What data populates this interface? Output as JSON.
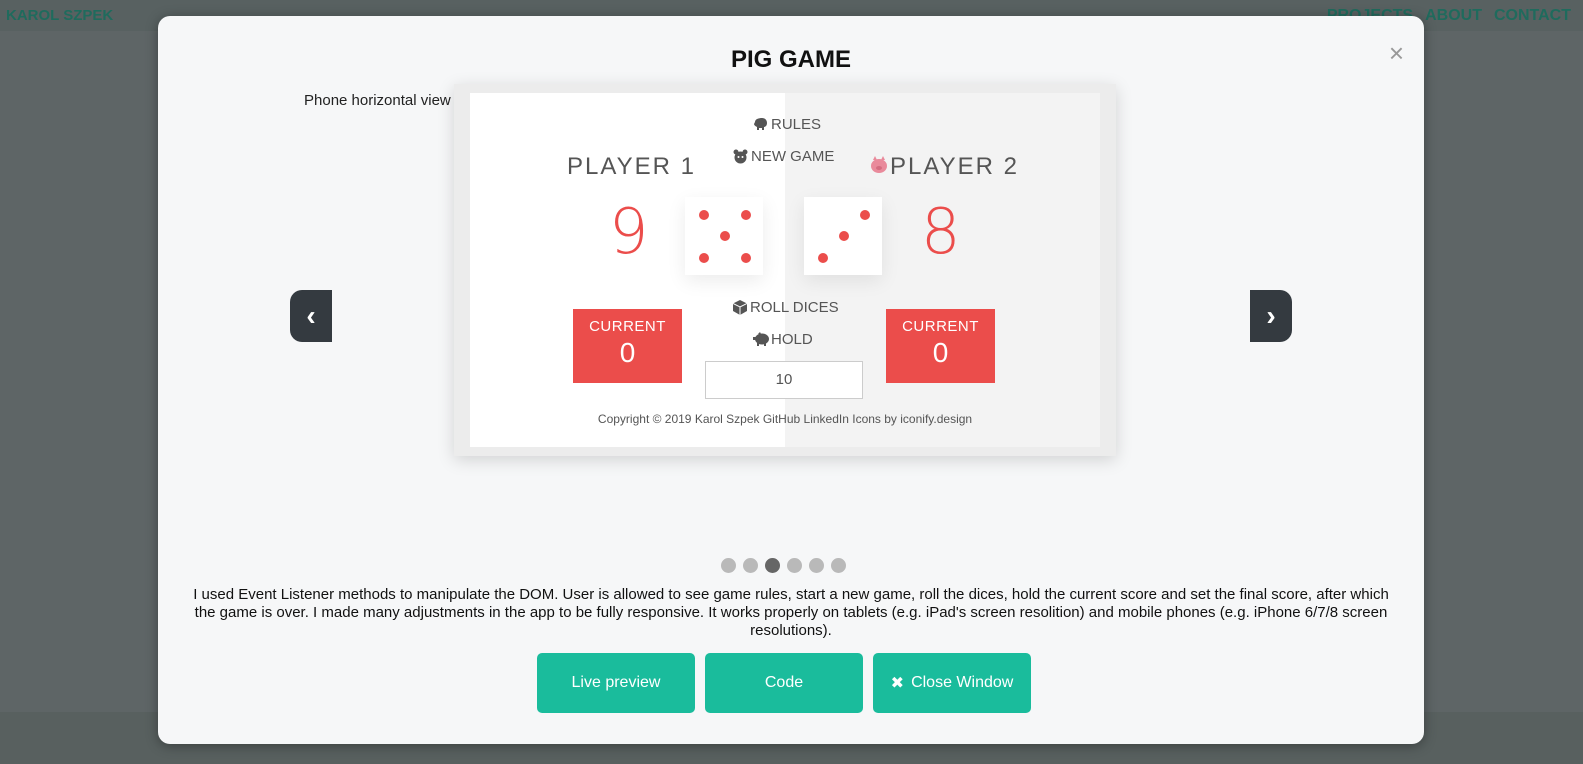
{
  "site": {
    "brand": "KAROL SZPEK",
    "nav": [
      "PROJECTS",
      "ABOUT",
      "CONTACT"
    ]
  },
  "modal": {
    "title": "PIG GAME",
    "close_icon": "×",
    "slide_caption": "Phone horizontal view",
    "prev_icon": "‹",
    "next_icon": "›",
    "slides_total": 6,
    "active_slide": 3,
    "description": "I used Event Listener methods to manipulate the DOM. User is allowed to see game rules, start a new game, roll the dices, hold the current score and set the final score, after which the game is over. I made many adjustments in the app to be fully responsive. It works properly on tablets (e.g. iPad's screen resolition) and mobile phones (e.g. iPhone 6/7/8 screen resolutions).",
    "buttons": {
      "live_preview": "Live preview",
      "code": "Code",
      "close_window": "Close Window",
      "close_window_icon": "✖"
    }
  },
  "game": {
    "rules": "RULES",
    "new_game": "NEW GAME",
    "roll_dices": "ROLL DICES",
    "hold": "HOLD",
    "player1": {
      "name": "PLAYER 1",
      "score": "9",
      "current_label": "CURRENT",
      "current": "0"
    },
    "player2": {
      "name": "PLAYER 2",
      "score": "8",
      "current_label": "CURRENT",
      "current": "0"
    },
    "dice1_value": 5,
    "dice2_value": 3,
    "final_score": "10",
    "footer": "Copyright © 2019 Karol Szpek  GitHub  LinkedIn  Icons by iconify.design",
    "accent_color": "#eb4d4b"
  },
  "colors": {
    "button": "#1abc9c",
    "carousel_control": "#343a40"
  },
  "icons": {
    "rules": "piggy-bank-icon",
    "new_game": "bear-icon",
    "roll": "dice-icon",
    "hold": "piggy-icon",
    "player2_active": "pig-icon"
  }
}
